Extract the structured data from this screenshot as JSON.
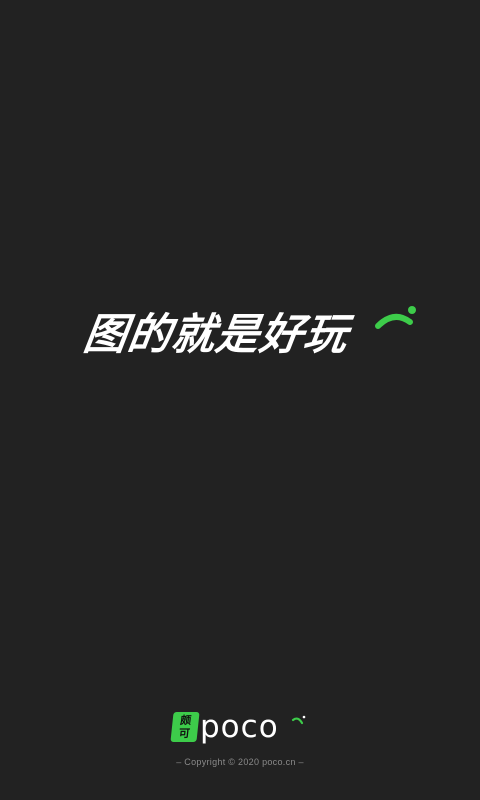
{
  "splash": {
    "slogan": "图的就是好玩",
    "logo": {
      "badge_top": "颇",
      "badge_bottom": "可",
      "wordmark": "poco"
    },
    "copyright": "– Copyright © 2020 poco.cn –"
  },
  "colors": {
    "background": "#222222",
    "accent_green": "#3dcc4a",
    "text_primary": "#ffffff",
    "text_muted": "#8a8a8a"
  }
}
